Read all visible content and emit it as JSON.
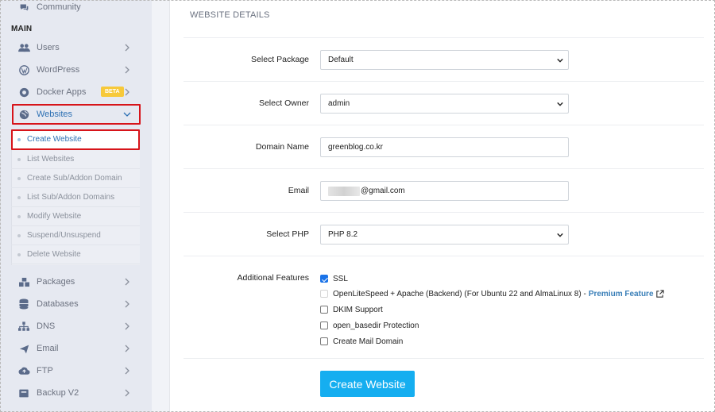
{
  "sidebar": {
    "community_label": "Community",
    "section_main": "MAIN",
    "items": [
      {
        "label": "Users",
        "icon": "users-icon"
      },
      {
        "label": "WordPress",
        "icon": "wordpress-icon"
      },
      {
        "label": "Docker Apps",
        "icon": "docker-icon",
        "badge": "BETA"
      },
      {
        "label": "Websites",
        "icon": "globe-icon",
        "active": true
      }
    ],
    "websites_submenu": [
      {
        "label": "Create Website",
        "active": true
      },
      {
        "label": "List Websites"
      },
      {
        "label": "Create Sub/Addon Domain"
      },
      {
        "label": "List Sub/Addon Domains"
      },
      {
        "label": "Modify Website"
      },
      {
        "label": "Suspend/Unsuspend"
      },
      {
        "label": "Delete Website"
      }
    ],
    "lower_items": [
      {
        "label": "Packages",
        "icon": "packages-icon"
      },
      {
        "label": "Databases",
        "icon": "database-icon"
      },
      {
        "label": "DNS",
        "icon": "sitemap-icon"
      },
      {
        "label": "Email",
        "icon": "send-icon"
      },
      {
        "label": "FTP",
        "icon": "cloud-upload-icon"
      },
      {
        "label": "Backup V2",
        "icon": "backup-icon"
      }
    ]
  },
  "form": {
    "title": "WEBSITE DETAILS",
    "package": {
      "label": "Select Package",
      "value": "Default"
    },
    "owner": {
      "label": "Select Owner",
      "value": "admin"
    },
    "domain": {
      "label": "Domain Name",
      "value": "greenblog.co.kr"
    },
    "email": {
      "label": "Email",
      "value": "@gmail.com"
    },
    "php": {
      "label": "Select PHP",
      "value": "PHP 8.2"
    },
    "features": {
      "label": "Additional Features",
      "options": [
        {
          "label": "SSL",
          "checked": true
        },
        {
          "label": "OpenLiteSpeed + Apache (Backend) (For Ubuntu 22 and AlmaLinux 8) -",
          "extra": "Premium Feature",
          "disabled": true
        },
        {
          "label": "DKIM Support",
          "checked": false
        },
        {
          "label": "open_basedir Protection",
          "checked": false
        },
        {
          "label": "Create Mail Domain",
          "checked": false
        }
      ]
    },
    "submit_label": "Create Website"
  },
  "colors": {
    "accent": "#15aef0",
    "highlight_box": "#d7141a",
    "link": "#2b6fb3"
  }
}
